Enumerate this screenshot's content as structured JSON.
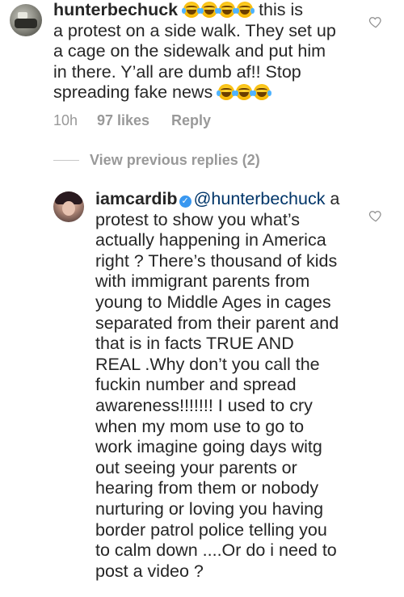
{
  "comment": {
    "username": "hunterbechuck",
    "text_part1": " this is\na protest on a side walk. They set up\na cage on the sidewalk and put him\nin there. Y’all are dumb af!! Stop\nspreading fake news ",
    "emoji_icon": "face-with-tears-of-joy-icon",
    "meta": {
      "time": "10h",
      "likes": "97 likes",
      "reply": "Reply"
    }
  },
  "view_previous_replies": "View previous replies (2)",
  "reply": {
    "username": "iamcardib",
    "verified_icon": "verified-badge-icon",
    "mention": "@hunterbechuck",
    "text": " a\nprotest to show you what’s\nactually happening in America\nright ? There’s thousand of kids\nwith immigrant parents from\nyoung to Middle Ages in cages\nseparated from their parent and\nthat is in facts TRUE AND\nREAL .Why don’t you call the\nfuckin number and spread\nawareness!!!!!!! I used to cry\nwhen my mom use to go to\nwork imagine going days witg\nout seeing your parents or\nhearing from them or nobody\nnurturing or loving you having\nborder patrol police telling you\nto calm down ....Or do i need to\npost a video ?"
  },
  "colors": {
    "text": "#262626",
    "meta": "#999999",
    "mention": "#003569",
    "verified": "#3897f0",
    "background": "#ffffff"
  }
}
